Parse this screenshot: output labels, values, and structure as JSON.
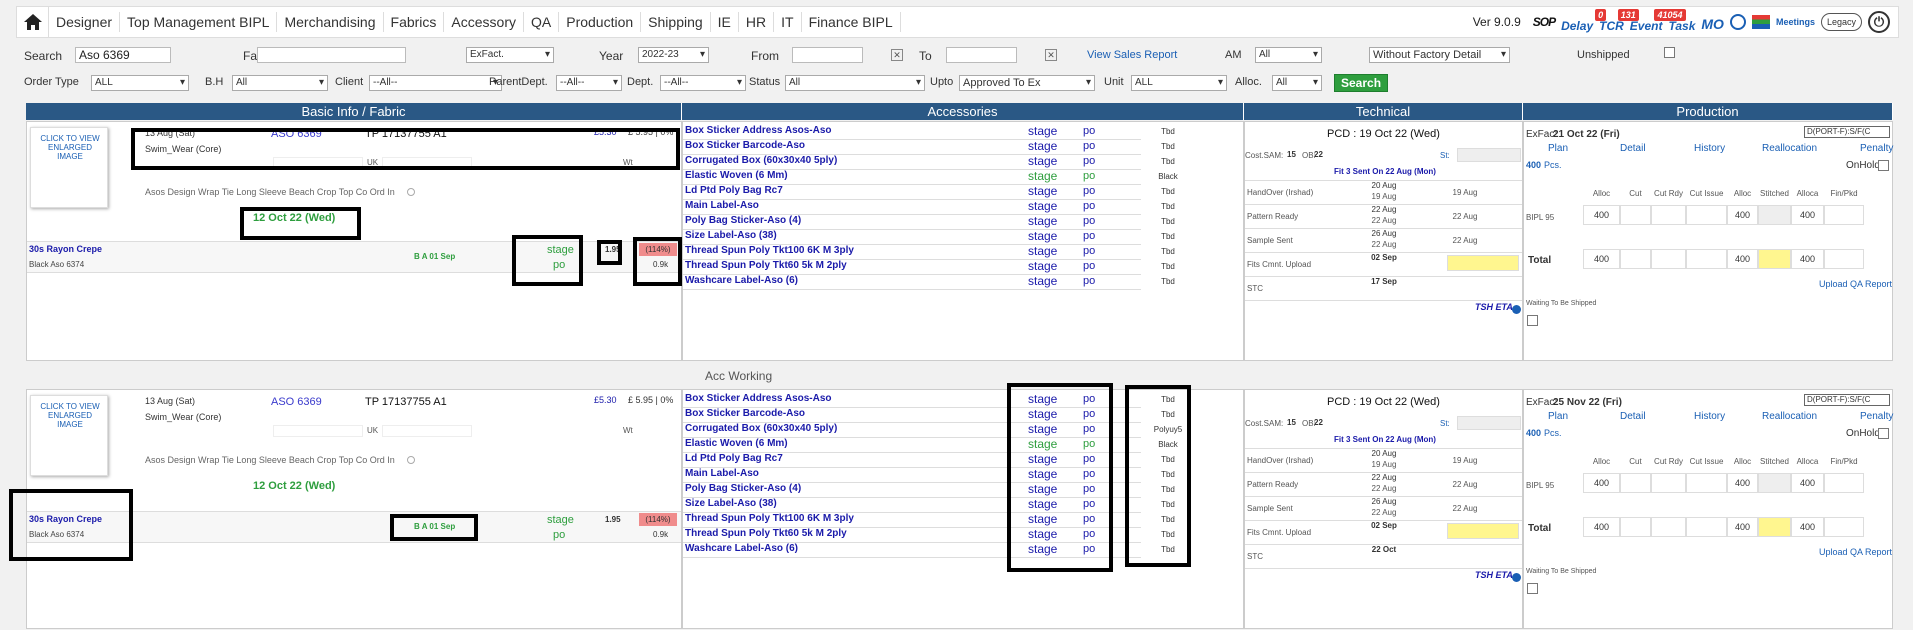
{
  "nav": {
    "items": [
      "Designer",
      "Top Management BIPL",
      "Merchandising",
      "Fabrics",
      "Accessory",
      "QA",
      "Production",
      "Shipping",
      "IE",
      "HR",
      "IT",
      "Finance BIPL"
    ],
    "version": "Ver 9.0.9",
    "sop": "SOP",
    "delay": "Delay",
    "tcr": "TCR",
    "tcr_badge": "0",
    "event": "Event",
    "event_badge": "131",
    "task": "Task",
    "task_badge": "41054",
    "mo": "MO",
    "meetings": "Meetings",
    "legacy": "Legacy"
  },
  "filters": {
    "search_label": "Search",
    "search_value": "Aso 6369",
    "fabric_label": "Fabric",
    "fabric_value": "",
    "exfact": "ExFact.",
    "year_label": "Year",
    "year_value": "2022-23",
    "from_label": "From",
    "to_label": "To",
    "view_sales": "View Sales Report",
    "am_label": "AM",
    "am_value": "All",
    "factory_detail": "Without Factory Detail",
    "unshipped_label": "Unshipped",
    "order_type_label": "Order Type",
    "order_type_value": "ALL",
    "bh_label": "B.H",
    "bh_value": "All",
    "client_label": "Client",
    "client_value": "--All--",
    "parentdept_label": "ParentDept.",
    "parentdept_value": "--All--",
    "dept_label": "Dept.",
    "dept_value": "--All--",
    "status_label": "Status",
    "status_value": "All",
    "upto_label": "Upto",
    "upto_value": "Approved To Ex",
    "unit_label": "Unit",
    "unit_value": "ALL",
    "alloc_label": "Alloc.",
    "alloc_value": "All",
    "search_button": "Search"
  },
  "headers": {
    "basic": "Basic Info / Fabric",
    "accessories": "Accessories",
    "technical": "Technical",
    "production": "Production"
  },
  "orders": [
    {
      "img_text": "CLICK TO VIEW ENLARGED IMAGE",
      "date": "13 Aug (Sat)",
      "style": "ASO 6369",
      "tp": "TP 17137755 A1",
      "price": "£5.30",
      "price2": "£ 5.95 | 0%",
      "category": "Swim_Wear (Core)",
      "uk": "UK",
      "wt": "Wt",
      "desc": "Asos Design Wrap Tie Long Sleeve Beach Crop Top Co Ord In",
      "exdate": "12 Oct 22 (Wed)",
      "fabric": "30s Rayon Crepe",
      "fabric_color": "Black Aso 6374",
      "ba": "B A 01 Sep",
      "fab_stage": "stage",
      "fab_po": "po",
      "fab_price": "1.95",
      "fab_pct": "(114%)",
      "fab_qty": "0.9k",
      "accessories": [
        {
          "name": "Box Sticker Address Asos-Aso",
          "stage": "stage",
          "po": "po",
          "val": "Tbd"
        },
        {
          "name": "Box Sticker Barcode-Aso",
          "stage": "stage",
          "po": "po",
          "val": "Tbd"
        },
        {
          "name": "Corrugated Box (60x30x40 5ply)",
          "stage": "stage",
          "po": "po",
          "val": "Tbd"
        },
        {
          "name": "Elastic Woven (6 Mm)",
          "stage": "stage",
          "po": "po",
          "val": "Black"
        },
        {
          "name": "Ld Ptd Poly Bag Rc7",
          "stage": "stage",
          "po": "po",
          "val": "Tbd"
        },
        {
          "name": "Main Label-Aso",
          "stage": "stage",
          "po": "po",
          "val": "Tbd"
        },
        {
          "name": "Poly Bag Sticker-Aso (4)",
          "stage": "stage",
          "po": "po",
          "val": "Tbd"
        },
        {
          "name": "Size Label-Aso (38)",
          "stage": "stage",
          "po": "po",
          "val": "Tbd"
        },
        {
          "name": "Thread Spun Poly Tkt100 6K M 3ply",
          "stage": "stage",
          "po": "po",
          "val": "Tbd"
        },
        {
          "name": "Thread Spun Poly Tkt60 5k M 2ply",
          "stage": "stage",
          "po": "po",
          "val": "Tbd"
        },
        {
          "name": "Washcare Label-Aso (6)",
          "stage": "stage",
          "po": "po",
          "val": "Tbd"
        }
      ],
      "pcd": "PCD : 19 Oct 22 (Wed)",
      "cost_sam_label": "Cost.SAM:",
      "cost_sam": "15",
      "ob_label": "OB:",
      "ob": "22",
      "st": "St:",
      "fit_sent": "Fit 3 Sent On 22 Aug (Mon)",
      "tech_rows": [
        {
          "label": "HandOver (Irshad)",
          "a": "20 Aug",
          "b": "19 Aug",
          "c": "19 Aug"
        },
        {
          "label": "Pattern Ready",
          "a": "22 Aug",
          "b": "22 Aug",
          "c": "22 Aug"
        },
        {
          "label": "Sample Sent",
          "a": "26 Aug",
          "b": "22 Aug",
          "c": "22 Aug"
        },
        {
          "label": "Fits Cmnt. Upload",
          "a": "02 Sep",
          "b": "",
          "c": ""
        },
        {
          "label": "STC",
          "a": "17 Sep",
          "b": "",
          "c": ""
        }
      ],
      "tsh_eta": "TSH ETA",
      "exfac_label": "ExFac:",
      "exfac": "21 Oct 22 (Fri)",
      "port": "D(PORT-F):S/F(C",
      "plan": "Plan",
      "detail": "Detail",
      "history": "History",
      "reallocation": "Reallocation",
      "penalty": "Penalty",
      "onhold": "OnHold",
      "pcs": "400",
      "pcs_unit": "Pcs.",
      "prod_cols": [
        "Alloc",
        "Cut",
        "Cut Rdy",
        "Cut Issue",
        "Alloc",
        "Stitched",
        "Alloca",
        "Fin/Pkd"
      ],
      "prod_unit": "BIPL 95",
      "prod_vals": [
        "400",
        "",
        "",
        "",
        "400",
        "",
        "400",
        ""
      ],
      "total_label": "Total",
      "total_vals": [
        "400",
        "",
        "",
        "",
        "400",
        "",
        "400",
        ""
      ],
      "upload_qa": "Upload QA Report",
      "waiting": "Waiting To Be Shipped"
    },
    {
      "img_text": "CLICK TO VIEW ENLARGED IMAGE",
      "date": "13 Aug (Sat)",
      "style": "ASO 6369",
      "tp": "TP 17137755 A1",
      "price": "£5.30",
      "price2": "£ 5.95 | 0%",
      "category": "Swim_Wear (Core)",
      "uk": "UK",
      "wt": "Wt",
      "desc": "Asos Design Wrap Tie Long Sleeve Beach Crop Top Co Ord In",
      "exdate": "12 Oct 22 (Wed)",
      "fabric": "30s Rayon Crepe",
      "fabric_color": "Black Aso 6374",
      "ba": "B A 01 Sep",
      "fab_stage": "stage",
      "fab_po": "po",
      "fab_price": "1.95",
      "fab_pct": "(114%)",
      "fab_qty": "0.9k",
      "accessories": [
        {
          "name": "Box Sticker Address Asos-Aso",
          "stage": "stage",
          "po": "po",
          "val": "Tbd"
        },
        {
          "name": "Box Sticker Barcode-Aso",
          "stage": "stage",
          "po": "po",
          "val": "Tbd"
        },
        {
          "name": "Corrugated Box (60x30x40 5ply)",
          "stage": "stage",
          "po": "po",
          "val": "Polyuy5"
        },
        {
          "name": "Elastic Woven (6 Mm)",
          "stage": "stage",
          "po": "po",
          "val": "Black"
        },
        {
          "name": "Ld Ptd Poly Bag Rc7",
          "stage": "stage",
          "po": "po",
          "val": "Tbd"
        },
        {
          "name": "Main Label-Aso",
          "stage": "stage",
          "po": "po",
          "val": "Tbd"
        },
        {
          "name": "Poly Bag Sticker-Aso (4)",
          "stage": "stage",
          "po": "po",
          "val": "Tbd"
        },
        {
          "name": "Size Label-Aso (38)",
          "stage": "stage",
          "po": "po",
          "val": "Tbd"
        },
        {
          "name": "Thread Spun Poly Tkt100 6K M 3ply",
          "stage": "stage",
          "po": "po",
          "val": "Tbd"
        },
        {
          "name": "Thread Spun Poly Tkt60 5k M 2ply",
          "stage": "stage",
          "po": "po",
          "val": "Tbd"
        },
        {
          "name": "Washcare Label-Aso (6)",
          "stage": "stage",
          "po": "po",
          "val": "Tbd"
        }
      ],
      "pcd": "PCD : 19 Oct 22 (Wed)",
      "cost_sam_label": "Cost.SAM:",
      "cost_sam": "15",
      "ob_label": "OB:",
      "ob": "22",
      "st": "St:",
      "fit_sent": "Fit 3 Sent On 22 Aug (Mon)",
      "tech_rows": [
        {
          "label": "HandOver (Irshad)",
          "a": "20 Aug",
          "b": "19 Aug",
          "c": "19 Aug"
        },
        {
          "label": "Pattern Ready",
          "a": "22 Aug",
          "b": "22 Aug",
          "c": "22 Aug"
        },
        {
          "label": "Sample Sent",
          "a": "26 Aug",
          "b": "22 Aug",
          "c": "22 Aug"
        },
        {
          "label": "Fits Cmnt. Upload",
          "a": "02 Sep",
          "b": "",
          "c": ""
        },
        {
          "label": "STC",
          "a": "22 Oct",
          "b": "",
          "c": ""
        }
      ],
      "tsh_eta": "TSH ETA",
      "exfac_label": "ExFac:",
      "exfac": "25 Nov 22 (Fri)",
      "port": "D(PORT-F):S/F(C",
      "plan": "Plan",
      "detail": "Detail",
      "history": "History",
      "reallocation": "Reallocation",
      "penalty": "Penalty",
      "onhold": "OnHold",
      "pcs": "400",
      "pcs_unit": "Pcs.",
      "prod_cols": [
        "Alloc",
        "Cut",
        "Cut Rdy",
        "Cut Issue",
        "Alloc",
        "Stitched",
        "Alloca",
        "Fin/Pkd"
      ],
      "prod_unit": "BIPL 95",
      "prod_vals": [
        "400",
        "",
        "",
        "",
        "400",
        "",
        "400",
        ""
      ],
      "total_label": "Total",
      "total_vals": [
        "400",
        "",
        "",
        "",
        "400",
        "",
        "400",
        ""
      ],
      "upload_qa": "Upload QA Report",
      "waiting": "Waiting To Be Shipped"
    }
  ],
  "acc_working": "Acc Working"
}
